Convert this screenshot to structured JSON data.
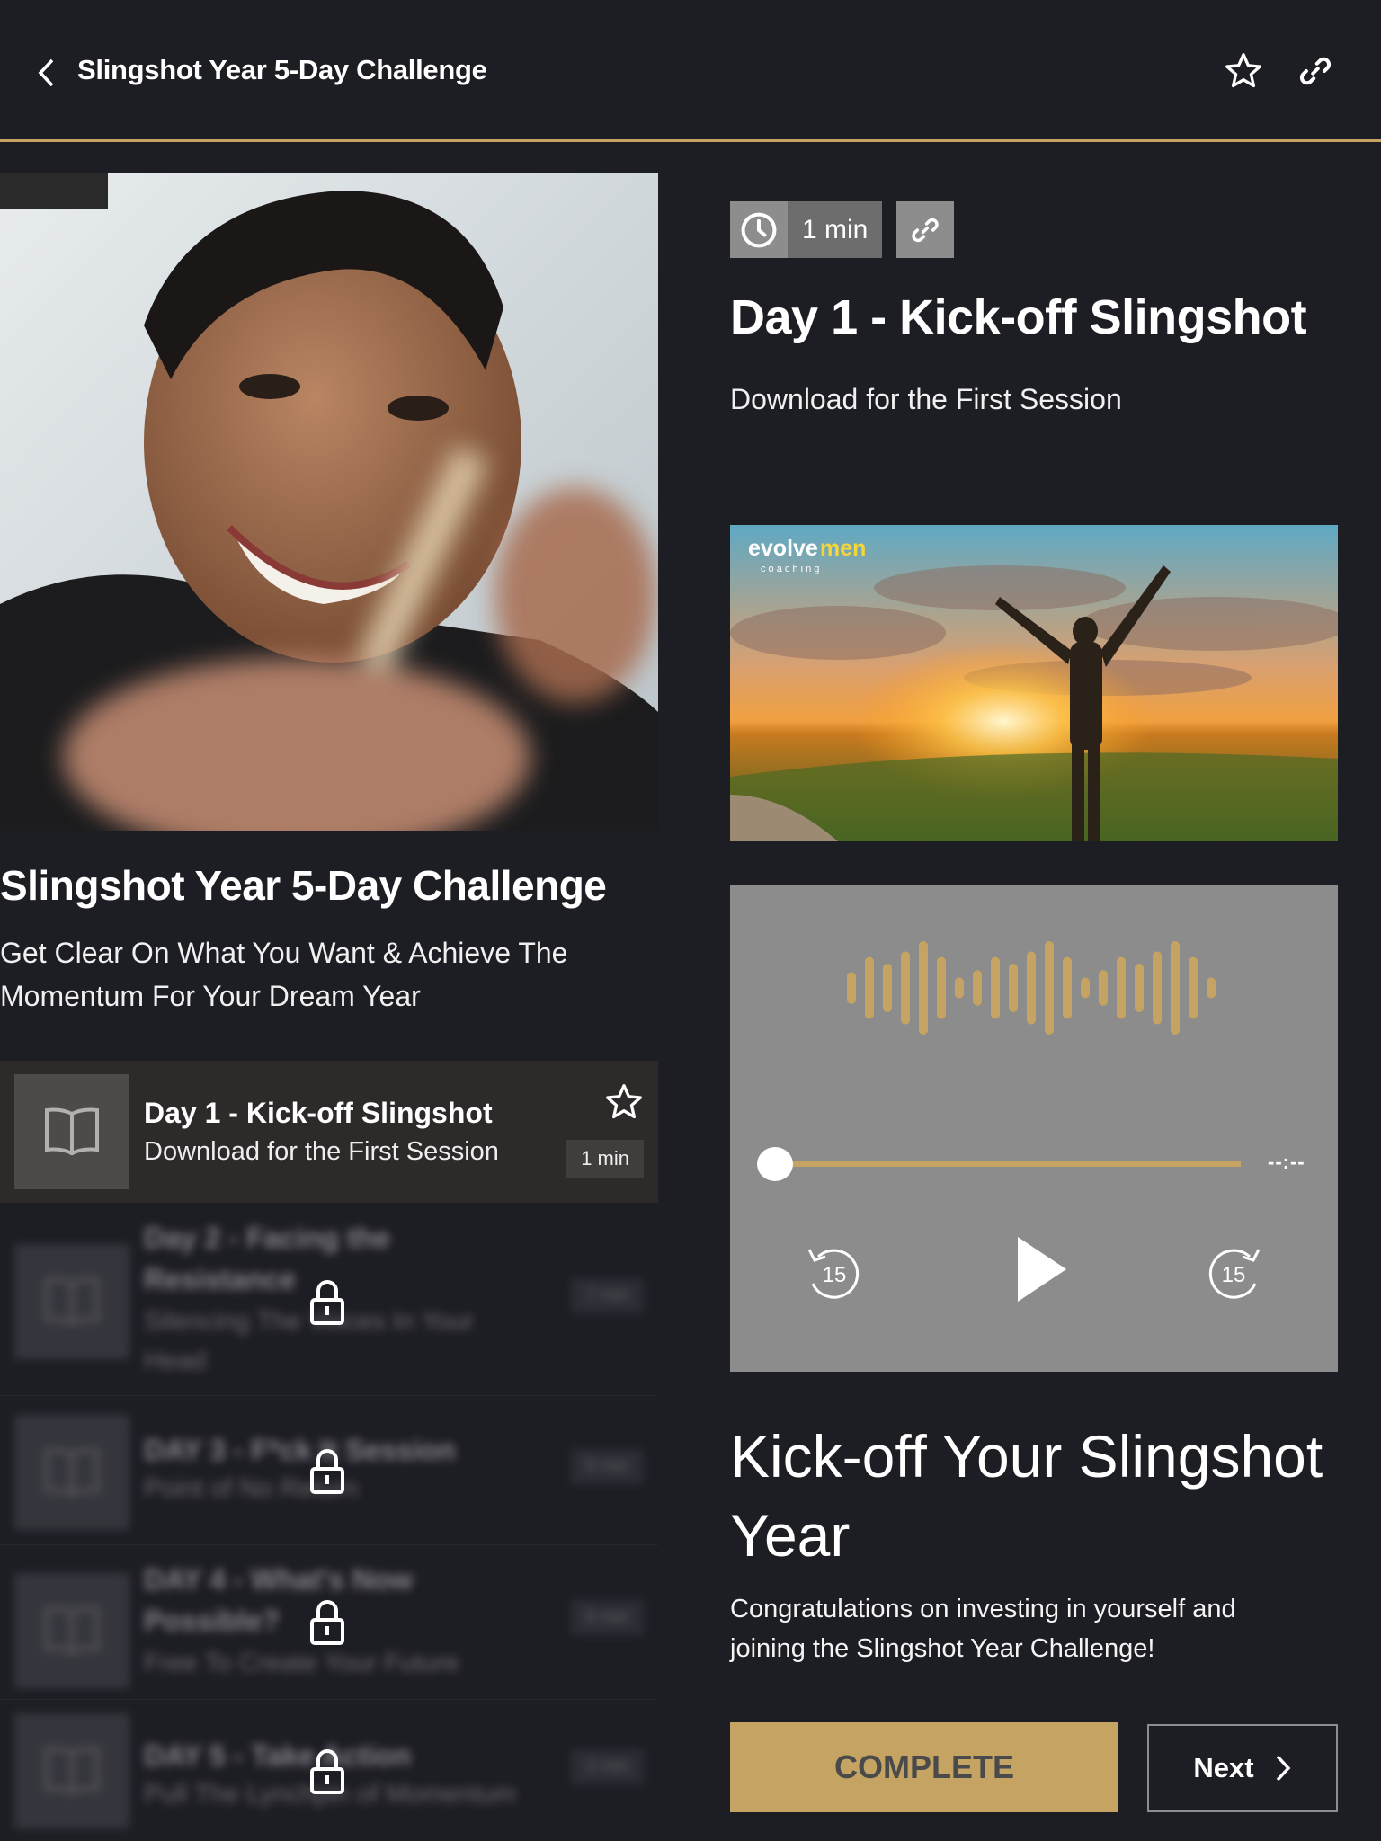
{
  "header": {
    "title": "Slingshot Year 5-Day Challenge",
    "back_icon": "chevron-left-icon",
    "favorite_icon": "star-outline-icon",
    "share_icon": "link-icon"
  },
  "course": {
    "title": "Slingshot Year 5-Day Challenge",
    "subtitle": "Get Clear On What You Want & Achieve The Momentum For Your Dream Year"
  },
  "lessons": [
    {
      "title": "Day 1 - Kick-off Slingshot",
      "subtitle": "Download for the First Session",
      "duration": "1 min",
      "locked": false,
      "active": true
    },
    {
      "title": "Day 2 - Facing the Resistance",
      "subtitle": "Silencing The Voices In Your Head",
      "duration": "7 min",
      "locked": true
    },
    {
      "title": "DAY 3 - F*ck It Session",
      "subtitle": "Point of No Return",
      "duration": "8 min",
      "locked": true
    },
    {
      "title": "DAY 4 - What's Now Possible?",
      "subtitle": "Free To Create Your Future",
      "duration": "8 min",
      "locked": true
    },
    {
      "title": "DAY 5 - Take Action",
      "subtitle": "Pull The Lynchpin of Momentum",
      "duration": "2 min",
      "locked": true
    }
  ],
  "current_lesson": {
    "duration": "1 min",
    "title": "Day 1 - Kick-off Slingshot",
    "subtitle": "Download for the First Session",
    "image_brand": {
      "word1": "evolve",
      "word2": "men",
      "tagline": "c o a c h i n g"
    }
  },
  "player": {
    "time_display": "--:--",
    "progress": 0,
    "skip_back_seconds": "15",
    "skip_forward_seconds": "15",
    "accent_color": "#c5a463"
  },
  "content": {
    "heading": "Kick-off Your Slingshot Year",
    "body": "Congratulations on investing in yourself and joining the Slingshot Year Challenge!"
  },
  "actions": {
    "complete_label": "COMPLETE",
    "next_label": "Next"
  },
  "colors": {
    "background": "#1d1d24",
    "accent": "#c5a463",
    "active_row": "#2e2a2a",
    "player_bg": "#8c8c8c"
  }
}
